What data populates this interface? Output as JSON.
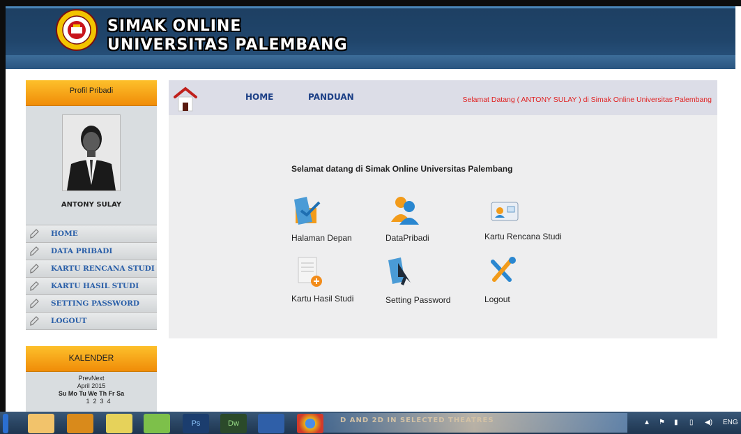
{
  "header": {
    "title_line1": "SIMAK ONLINE",
    "title_line2": "UNIVERSITAS PALEMBANG"
  },
  "sidebar": {
    "profile_heading": "Profil Pribadi",
    "profile_name": "ANTONY SULAY",
    "menu": [
      {
        "label": "HOME"
      },
      {
        "label": "DATA PRIBADI"
      },
      {
        "label": "KARTU RENCANA STUDI"
      },
      {
        "label": "KARTU HASIL STUDI"
      },
      {
        "label": "SETTING PASSWORD"
      },
      {
        "label": "LOGOUT"
      }
    ]
  },
  "calendar": {
    "heading": "KALENDER",
    "nav": "PrevNext",
    "month": "April 2015",
    "weekdays": "Su Mo Tu We Th Fr Sa",
    "first_row": "1  2  3  4"
  },
  "topnav": {
    "home": "HOME",
    "panduan": "PANDUAN",
    "welcome": "Selamat Datang ( ANTONY SULAY ) di Simak Online Universitas Palembang"
  },
  "main": {
    "welcome_text": "Selamat datang di Simak Online Universitas Palembang",
    "tiles": [
      {
        "label": "Halaman Depan",
        "icon": "folder-icon"
      },
      {
        "label": "DataPribadi",
        "icon": "user-icon"
      },
      {
        "label": "Kartu Rencana Studi",
        "icon": "card-icon"
      },
      {
        "label": "Kartu Hasil Studi",
        "icon": "document-add-icon"
      },
      {
        "label": "Setting Password",
        "icon": "cursor-icon"
      },
      {
        "label": "Logout",
        "icon": "tools-icon"
      }
    ]
  },
  "taskbar": {
    "banner_text": "D AND 2D IN SELECTED THEATRES",
    "language": "ENG"
  },
  "colors": {
    "header_bg": "#20456b",
    "accent_orange": "#f08c08",
    "menu_link": "#2a5fa8",
    "nav_link": "#1c3f86",
    "welcome_red": "#e02020"
  }
}
